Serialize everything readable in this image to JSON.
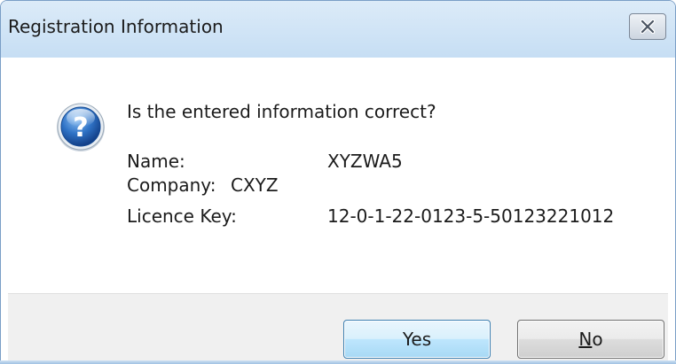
{
  "window": {
    "title": "Registration Information",
    "close_icon": "close-x-icon",
    "title_bar_color": "#c6def4"
  },
  "dialog": {
    "icon": "question-icon",
    "icon_color": "#1c5cab",
    "message": "Is the entered information correct?",
    "fields": {
      "name_label": "Name:",
      "name_value": "XYZWA5",
      "company_label": "Company:",
      "company_value": "CXYZ",
      "licence_label": "Licence Key:",
      "licence_value": "12-0-1-22-0123-5-50123221012"
    }
  },
  "buttons": {
    "yes_label": "Yes",
    "no_label": "No",
    "no_mnemonic": "N",
    "no_rest": "o"
  }
}
